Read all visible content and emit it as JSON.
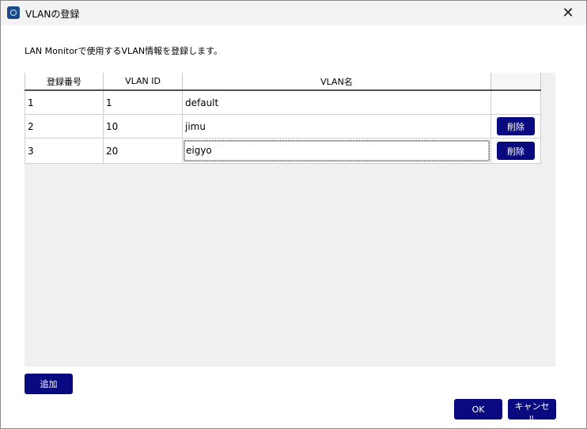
{
  "window": {
    "title": "VLANの登録",
    "close_glyph": "✕"
  },
  "description": "LAN Monitorで使用するVLAN情報を登録します。",
  "table": {
    "headers": [
      "登録番号",
      "VLAN ID",
      "VLAN名",
      ""
    ],
    "rows": [
      {
        "number": "1",
        "vlan_id": "1",
        "name": "default",
        "action": ""
      },
      {
        "number": "2",
        "vlan_id": "10",
        "name": "jimu",
        "action": "削除"
      },
      {
        "number": "3",
        "vlan_id": "20",
        "name": "eigyo",
        "action": "削除"
      }
    ]
  },
  "buttons": {
    "add": "追加",
    "ok": "OK",
    "cancel": "キャンセル"
  },
  "colors": {
    "button_bg": "#0a0a80",
    "button_text": "#ffffff",
    "grid_bg": "#f0f0f0"
  }
}
